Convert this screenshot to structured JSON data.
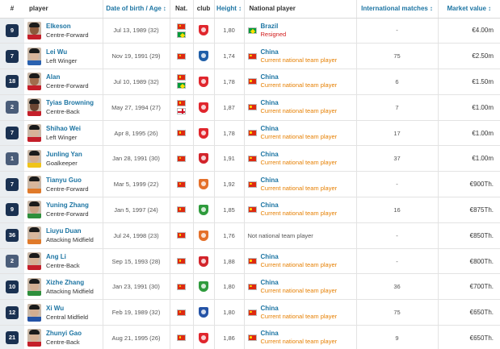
{
  "headers": {
    "num": "#",
    "player": "player",
    "dob": "Date of birth / Age",
    "nat": "Nat.",
    "club": "club",
    "height": "Height",
    "national_player": "National player",
    "intl_matches": "International matches",
    "market_value": "Market value",
    "sort_arrow": "↕"
  },
  "rows": [
    {
      "number": "9",
      "name": "Elkeson",
      "position": "Centre-Forward",
      "dob": "Jul 13, 1989 (32)",
      "nat_flags": [
        "flag-china",
        "flag-brazil"
      ],
      "club_crest": "guangzhou-crest",
      "club_color": "#e0262d",
      "height": "1,80",
      "national_flag": "flag-brazil",
      "national_team": "Brazil",
      "national_status": "Resigned",
      "status_color": "red",
      "matches": "-",
      "value": "€4.00m",
      "face": "#8a5a3c",
      "shirt": "#c41f2a"
    },
    {
      "number": "7",
      "name": "Lei Wu",
      "position": "Left Winger",
      "dob": "Nov 19, 1991 (29)",
      "nat_flags": [
        "flag-china"
      ],
      "club_crest": "espanyol-crest",
      "club_color": "#1f5ea8",
      "height": "1,74",
      "national_flag": "flag-china",
      "national_team": "China",
      "national_status": "Current national team player",
      "status_color": "orange",
      "matches": "75",
      "value": "€2.50m",
      "face": "#d9b59a",
      "shirt": "#2a62b0"
    },
    {
      "number": "18",
      "name": "Alan",
      "position": "Centre-Forward",
      "dob": "Jul 10, 1989 (32)",
      "nat_flags": [
        "flag-china",
        "flag-brazil"
      ],
      "club_crest": "guangzhou-crest",
      "club_color": "#e0262d",
      "height": "1,78",
      "national_flag": "flag-china",
      "national_team": "China",
      "national_status": "Current national team player",
      "status_color": "orange",
      "matches": "6",
      "value": "€1.50m",
      "face": "#a06d4d",
      "shirt": "#c41f2a"
    },
    {
      "number": "2",
      "name": "Tyias Browning",
      "position": "Centre-Back",
      "dob": "May 27, 1994 (27)",
      "nat_flags": [
        "flag-china",
        "flag-england"
      ],
      "club_crest": "guangzhou-crest",
      "club_color": "#e0262d",
      "height": "1,87",
      "national_flag": "flag-china",
      "national_team": "China",
      "national_status": "Current national team player",
      "status_color": "orange",
      "matches": "7",
      "value": "€1.00m",
      "face": "#6b4532",
      "shirt": "#c41f2a"
    },
    {
      "number": "7",
      "name": "Shihao Wei",
      "position": "Left Winger",
      "dob": "Apr 8, 1995 (26)",
      "nat_flags": [
        "flag-china"
      ],
      "club_crest": "guangzhou-crest",
      "club_color": "#e0262d",
      "height": "1,78",
      "national_flag": "flag-china",
      "national_team": "China",
      "national_status": "Current national team player",
      "status_color": "orange",
      "matches": "17",
      "value": "€1.00m",
      "face": "#d7b398",
      "shirt": "#c41f2a"
    },
    {
      "number": "1",
      "name": "Junling Yan",
      "position": "Goalkeeper",
      "dob": "Jan 28, 1991 (30)",
      "nat_flags": [
        "flag-china"
      ],
      "club_crest": "shanghai-port-crest",
      "club_color": "#d2242b",
      "height": "1,91",
      "national_flag": "flag-china",
      "national_team": "China",
      "national_status": "Current national team player",
      "status_color": "orange",
      "matches": "37",
      "value": "€1.00m",
      "face": "#d4ad90",
      "shirt": "#f0c419"
    },
    {
      "number": "7",
      "name": "Tianyu Guo",
      "position": "Centre-Forward",
      "dob": "Mar 5, 1999 (22)",
      "nat_flags": [
        "flag-china"
      ],
      "club_crest": "shandong-crest",
      "club_color": "#e4702a",
      "height": "1,92",
      "national_flag": "flag-china",
      "national_team": "China",
      "national_status": "Current national team player",
      "status_color": "orange",
      "matches": "-",
      "value": "€900Th.",
      "face": "#d8b69b",
      "shirt": "#e07a2a"
    },
    {
      "number": "9",
      "name": "Yuning Zhang",
      "position": "Centre-Forward",
      "dob": "Jan 5, 1997 (24)",
      "nat_flags": [
        "flag-china"
      ],
      "club_crest": "beijing-guoan-crest",
      "club_color": "#2e9b3c",
      "height": "1,85",
      "national_flag": "flag-china",
      "national_team": "China",
      "national_status": "Current national team player",
      "status_color": "orange",
      "matches": "16",
      "value": "€875Th.",
      "face": "#c9a284",
      "shirt": "#2e8f3c"
    },
    {
      "number": "36",
      "name": "Liuyu Duan",
      "position": "Attacking Midfield",
      "dob": "Jul 24, 1998 (23)",
      "nat_flags": [
        "flag-china"
      ],
      "club_crest": "shandong-crest",
      "club_color": "#e4702a",
      "height": "1,76",
      "national_flag": "",
      "national_team": "",
      "national_status": "",
      "not_national": "Not national team player",
      "status_color": "orange",
      "matches": "-",
      "value": "€850Th.",
      "face": "#d9b89e",
      "shirt": "#e07a2a"
    },
    {
      "number": "2",
      "name": "Ang Li",
      "position": "Centre-Back",
      "dob": "Sep 15, 1993 (28)",
      "nat_flags": [
        "flag-china"
      ],
      "club_crest": "shanghai-port-crest",
      "club_color": "#d2242b",
      "height": "1,88",
      "national_flag": "flag-china",
      "national_team": "China",
      "national_status": "Current national team player",
      "status_color": "orange",
      "matches": "-",
      "value": "€800Th.",
      "face": "#d6b295",
      "shirt": "#c41f2a"
    },
    {
      "number": "10",
      "name": "Xizhe Zhang",
      "position": "Attacking Midfield",
      "dob": "Jan 23, 1991 (30)",
      "nat_flags": [
        "flag-china"
      ],
      "club_crest": "beijing-guoan-crest",
      "club_color": "#2e9b3c",
      "height": "1,80",
      "national_flag": "flag-china",
      "national_team": "China",
      "national_status": "Current national team player",
      "status_color": "orange",
      "matches": "36",
      "value": "€700Th.",
      "face": "#d3ae92",
      "shirt": "#2e8f3c"
    },
    {
      "number": "12",
      "name": "Xi Wu",
      "position": "Central Midfield",
      "dob": "Feb 19, 1989 (32)",
      "nat_flags": [
        "flag-china"
      ],
      "club_crest": "shanghai-shenhua-crest",
      "club_color": "#2453a6",
      "height": "1,80",
      "national_flag": "flag-china",
      "national_team": "China",
      "national_status": "Current national team player",
      "status_color": "orange",
      "matches": "75",
      "value": "€650Th.",
      "face": "#d2ad90",
      "shirt": "#2453a6"
    },
    {
      "number": "21",
      "name": "Zhunyi Gao",
      "position": "Centre-Back",
      "dob": "Aug 21, 1995 (26)",
      "nat_flags": [
        "flag-china"
      ],
      "club_crest": "guangzhou-crest",
      "club_color": "#e0262d",
      "height": "1,86",
      "national_flag": "flag-china",
      "national_team": "China",
      "national_status": "Current national team player",
      "status_color": "orange",
      "matches": "9",
      "value": "€650Th.",
      "face": "#d5b094",
      "shirt": "#c41f2a"
    }
  ]
}
